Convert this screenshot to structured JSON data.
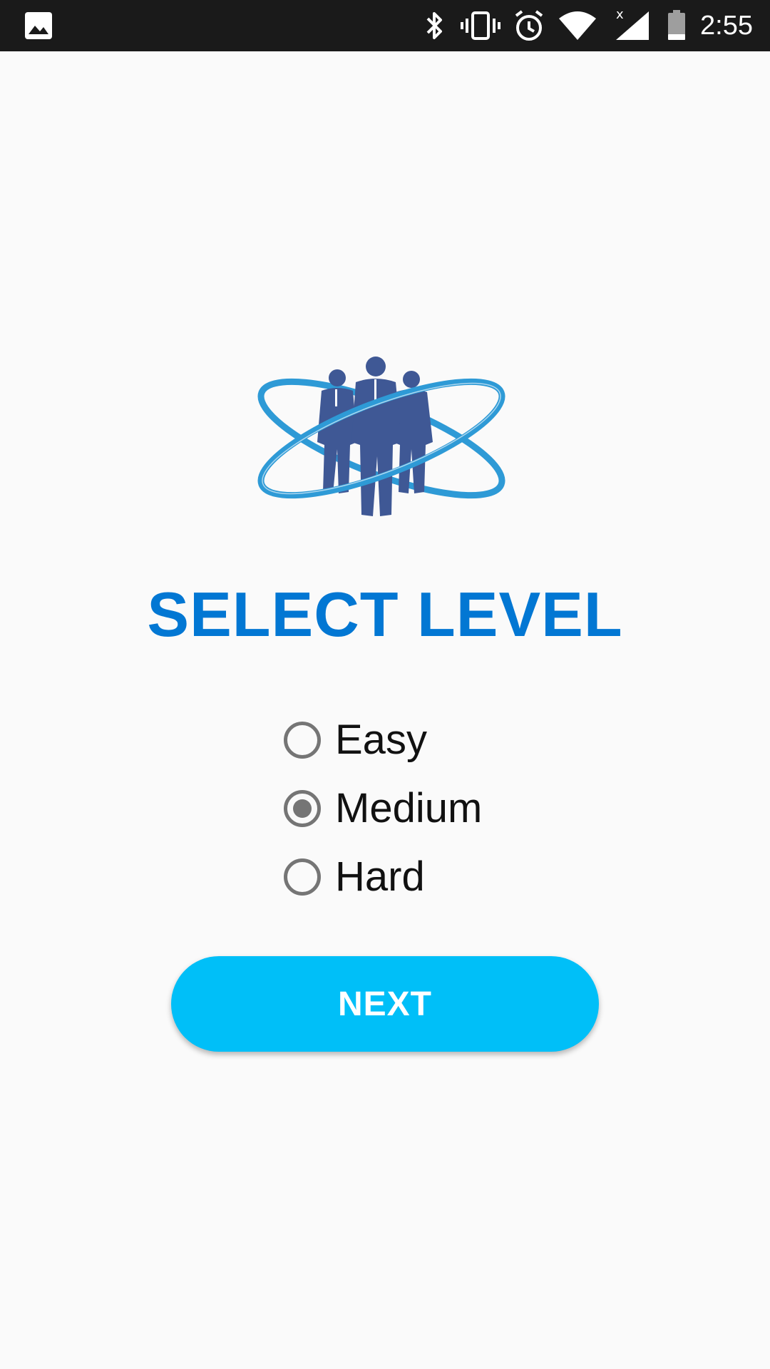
{
  "status_bar": {
    "time": "2:55",
    "icons": [
      "gallery-icon",
      "bluetooth-icon",
      "vibrate-icon",
      "alarm-icon",
      "wifi-icon",
      "cell-signal-icon",
      "battery-icon"
    ]
  },
  "logo": {
    "icon": "business-team-logo",
    "colors": {
      "figures": "#3f5895",
      "orbits": "#2e9ad6"
    }
  },
  "title": "SELECT LEVEL",
  "levels": [
    {
      "label": "Easy",
      "checked": false
    },
    {
      "label": "Medium",
      "checked": true
    },
    {
      "label": "Hard",
      "checked": false
    }
  ],
  "next_button": {
    "label": "NEXT"
  },
  "colors": {
    "title": "#0277d3",
    "button": "#00bff8",
    "radio": "#757575",
    "background": "#fafafa",
    "status_bar": "#1a1a1a"
  }
}
